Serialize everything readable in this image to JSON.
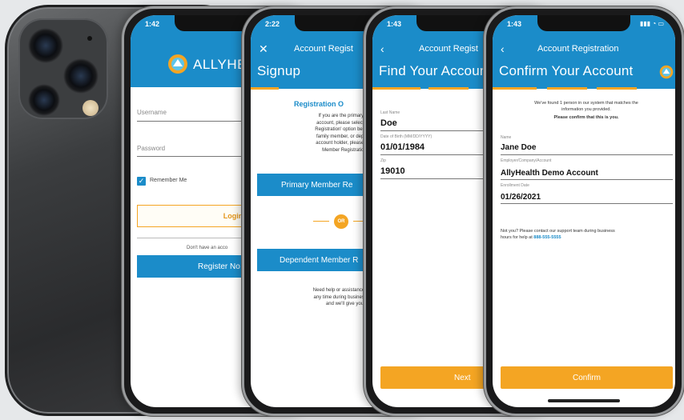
{
  "login": {
    "time": "1:42",
    "brand": "ALLYHE",
    "username_label": "Username",
    "password_label": "Password",
    "remember_label": "Remember Me",
    "login_btn": "Login",
    "no_account": "Don't have an acco",
    "register_btn": "Register No"
  },
  "signup": {
    "time": "2:22",
    "close": "✕",
    "header_title": "Account Regist",
    "big_title": "Signup",
    "section_title": "Registration O",
    "intro_1": "If you are the primary acco",
    "intro_2": "account, please select the 'F",
    "intro_3": "Registration' option below. If y",
    "intro_4": "family member, or dependen",
    "intro_5": "account holder, please select",
    "intro_6": "Member Registration' o",
    "primary_btn": "Primary Member Re",
    "or": "OR",
    "dependent_btn": "Dependent Member R",
    "help_1": "Need help or assistance? Call c",
    "help_2": "any time during business hours",
    "help_3": "and we'll give you a"
  },
  "find": {
    "time": "1:43",
    "back": "‹",
    "header_title": "Account Regist",
    "big_title": "Find Your Account",
    "last_name_label": "Last Name",
    "last_name": "Doe",
    "dob_label": "Date of Birth (MM/DD/YYYY)",
    "dob": "01/01/1984",
    "zip_label": "Zip",
    "zip": "19010",
    "next_btn": "Next"
  },
  "confirm": {
    "time": "1:43",
    "back": "‹",
    "header_title": "Account Registration",
    "big_title": "Confirm Your Account",
    "found_1": "We've found 1 person in our system that matches the",
    "found_2": "information you provided.",
    "please_confirm": "Please confirm that this is you.",
    "name_label": "Name",
    "name": "Jane Doe",
    "employer_label": "Employer/Company/Account",
    "employer": "AllyHealth Demo Account",
    "enroll_label": "Enrollment Date",
    "enroll": "01/26/2021",
    "not_you_1": "Not you? Please contact our support team during business",
    "not_you_2": "hours for help at",
    "phone": "888-555-5555",
    "confirm_btn": "Confirm"
  },
  "colors": {
    "brand_blue": "#1b8cc9",
    "accent_orange": "#f4a523"
  }
}
